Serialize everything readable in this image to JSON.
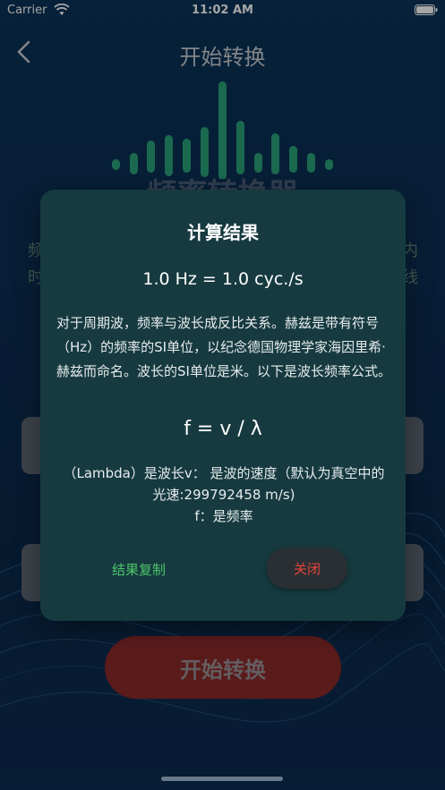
{
  "status_bar": {
    "carrier": "Carrier",
    "time": "11:02 AM"
  },
  "nav": {
    "title": "开始转换"
  },
  "background": {
    "heading": "频率转换器",
    "left_fragment_1": "频",
    "left_fragment_2": "时",
    "right_fragment_1": "内",
    "right_fragment_2": "线",
    "start_button": "开始转换"
  },
  "dialog": {
    "title": "计算结果",
    "result": "1.0 Hz = 1.0 cyc./s",
    "description": "对于周期波，频率与波长成反比关系。赫兹是带有符号（Hz）的频率的SI单位，以纪念德国物理学家海因里希·赫兹而命名。波长的SI单位是米。以下是波长频率公式。",
    "formula": "f = v / λ",
    "variables_line_1": "（Lambda）是波长v： 是波的速度（默认为真空中的光速:299792458 m/s)",
    "variables_line_2": "f：是频率",
    "copy_label": "结果复制",
    "close_label": "关闭"
  },
  "colors": {
    "accent_green": "#4cc46a",
    "close_red": "#e8443c",
    "dialog_bg": "#163a3f"
  }
}
